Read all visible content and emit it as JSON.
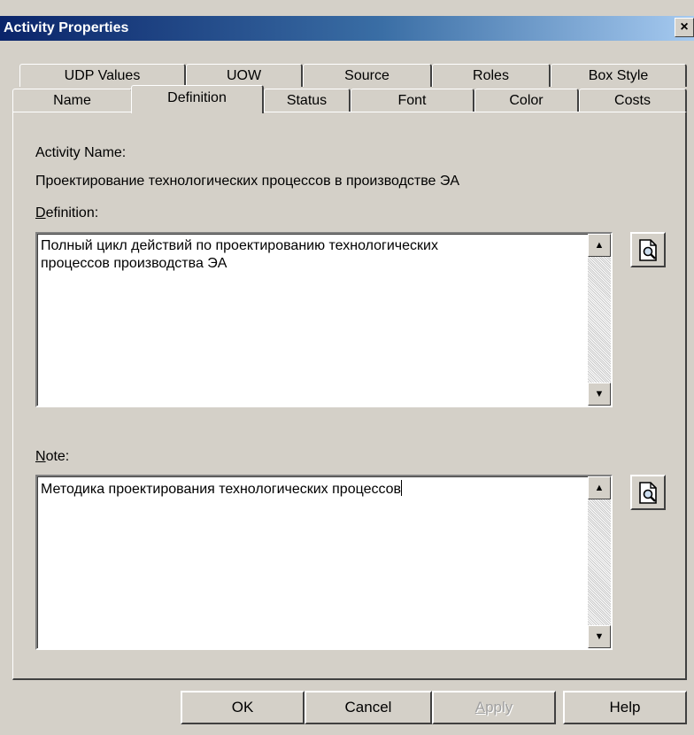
{
  "window": {
    "title": "Activity Properties",
    "close_glyph": "×"
  },
  "tabs_back": [
    {
      "label": "UDP Values"
    },
    {
      "label": "UOW"
    },
    {
      "label": "Source"
    },
    {
      "label": "Roles"
    },
    {
      "label": "Box Style"
    }
  ],
  "tabs_front": [
    {
      "label": "Name"
    },
    {
      "label": "Definition",
      "active": true
    },
    {
      "label": "Status"
    },
    {
      "label": "Font"
    },
    {
      "label": "Color"
    },
    {
      "label": "Costs"
    }
  ],
  "activity": {
    "name_label": "Activity Name:",
    "name_value": "Проектирование технологических процессов в производстве ЭА"
  },
  "definition": {
    "label_accel": "D",
    "label_rest": "efinition:",
    "value": "Полный цикл действий по проектированию технологических\nпроцессов производства ЭА"
  },
  "note": {
    "label_accel": "N",
    "label_rest": "ote:",
    "value": "Методика проектирования технологических процессов"
  },
  "scroll": {
    "up_glyph": "▲",
    "down_glyph": "▼"
  },
  "icons": {
    "preview": "document-preview-icon"
  },
  "buttons": {
    "ok": "OK",
    "cancel": "Cancel",
    "apply_accel": "A",
    "apply_rest": "pply",
    "help": "Help"
  }
}
